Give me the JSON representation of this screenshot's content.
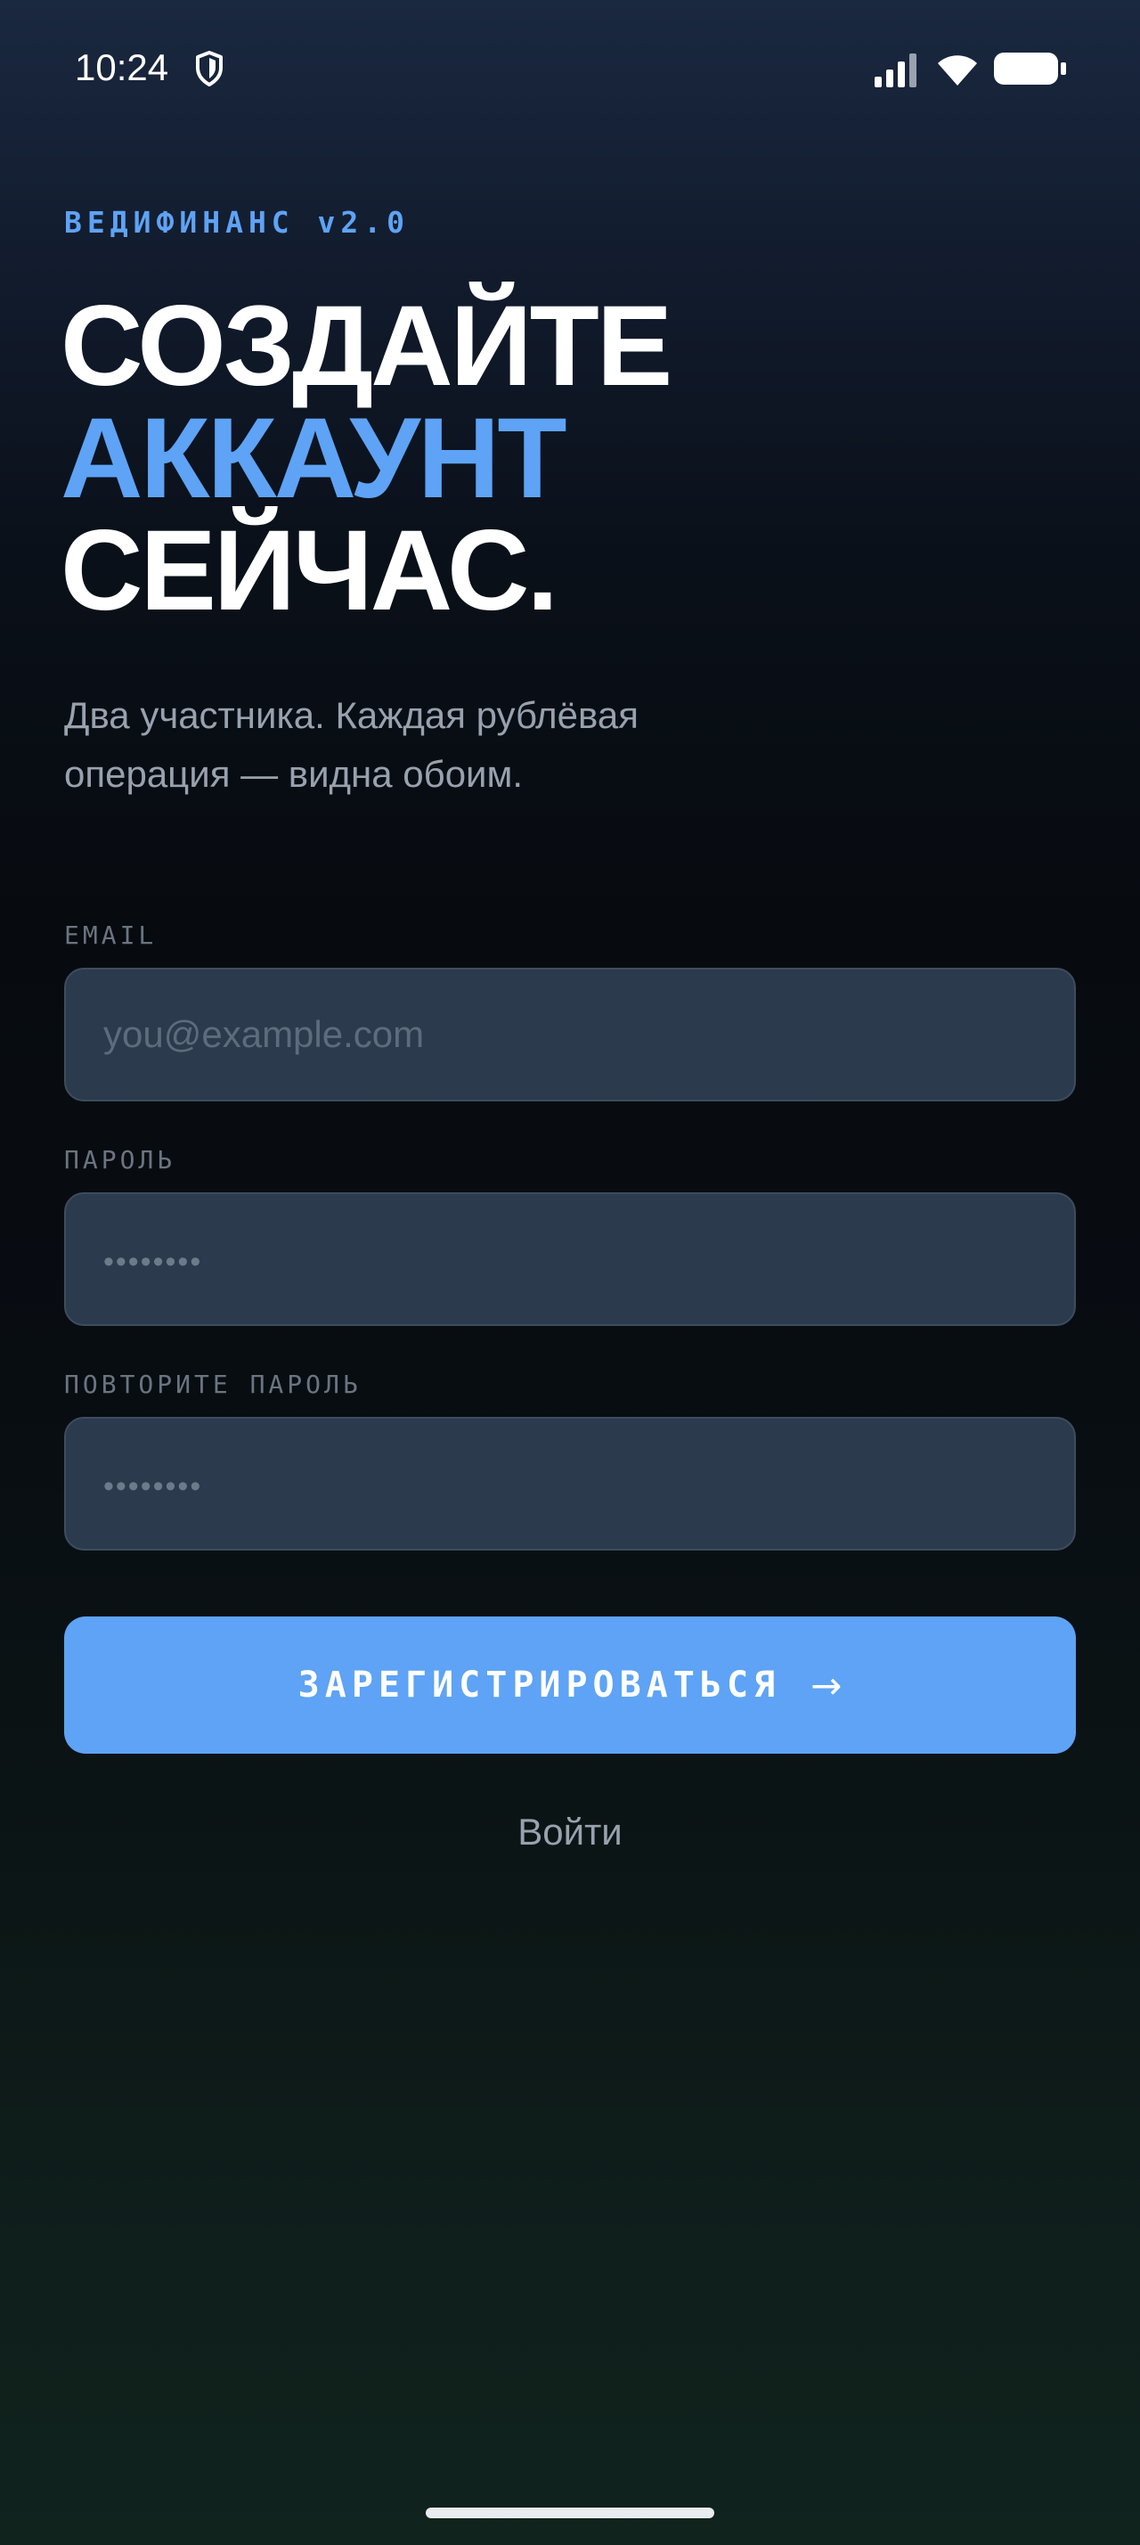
{
  "status_bar": {
    "time": "10:24",
    "icons": [
      "shield-icon",
      "signal-icon",
      "wifi-icon",
      "battery-icon"
    ]
  },
  "brand": "ВЕДИФИНАНС v2.0",
  "headline": {
    "line1": "СОЗДАЙТЕ",
    "line2": "АККАУНТ",
    "line3": "СЕЙЧАС."
  },
  "subtitle": {
    "line1": "Два участника. Каждая рублёвая",
    "line2": "операция — видна обоим."
  },
  "form": {
    "email": {
      "label": "EMAIL",
      "placeholder": "you@example.com",
      "value": ""
    },
    "password": {
      "label": "ПАРОЛЬ",
      "placeholder": "••••••••",
      "value": ""
    },
    "password_repeat": {
      "label": "ПОВТОРИТЕ ПАРОЛЬ",
      "placeholder": "••••••••",
      "value": ""
    },
    "submit_label": "ЗАРЕГИСТРИРОВАТЬСЯ",
    "submit_arrow": "→"
  },
  "login_link": "Войти",
  "colors": {
    "accent": "#5ea3f5",
    "input_bg": "#2b3a4c",
    "muted_text": "#98a1ad"
  }
}
